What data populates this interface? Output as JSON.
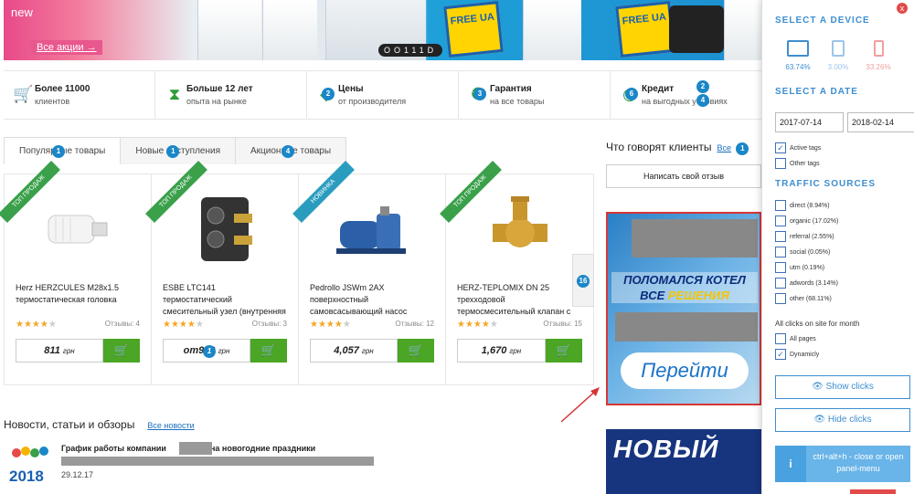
{
  "banner": {
    "new_label": "new",
    "all_promos_label": "Все акции →",
    "slider_dots": "OO111D",
    "free_badge_text": "FREE UA"
  },
  "features": [
    {
      "icon": "cart-icon",
      "title": "Более 11000",
      "sub": "клиентов",
      "badge": ""
    },
    {
      "icon": "hourglass-icon",
      "title": "Больше 12 лет",
      "sub": "опыта на рынке",
      "badge": ""
    },
    {
      "icon": "price-tag-icon",
      "title": "Цены",
      "sub": "от производителя",
      "badge": "2"
    },
    {
      "icon": "guarantee-icon",
      "title": "Гарантия",
      "sub": "на все товары",
      "badge": "3"
    },
    {
      "icon": "credit-icon",
      "title": "Кредит",
      "sub": "на выгодных условиях",
      "badge": "6"
    }
  ],
  "feature_extra_badges": {
    "credit_top": "2",
    "credit_bottom": "4"
  },
  "tabs": [
    {
      "label": "Популярные товары",
      "badge": "1"
    },
    {
      "label": "Новые поступления",
      "badge": "1"
    },
    {
      "label": "Акционные товары",
      "badge": "4"
    }
  ],
  "products": [
    {
      "ribbon": "ТОП ПРОДАЖ",
      "ribbon_type": "top",
      "name": "Herz HERZCULES M28x1.5 термостатическая головка",
      "stars": "★★★★",
      "star_off": "★",
      "reviews": "Отзывы: 4",
      "price": "811",
      "currency": "грн",
      "badge": ""
    },
    {
      "ribbon": "ТОП ПРОДАЖ",
      "ribbon_type": "top",
      "name": "ESBE LTC141 термостатический смесительный узел (внутренняя",
      "stars": "★★★★",
      "star_off": "★",
      "reviews": "Отзывы: 3",
      "price": "от9,  0",
      "currency": "грн",
      "badge": "1"
    },
    {
      "ribbon": "НОВИНКА",
      "ribbon_type": "new",
      "name": "Pedrollo JSWm 2AX поверхностный самовсасывающий насос",
      "stars": "★★★★",
      "star_off": "★",
      "reviews": "Отзывы: 12",
      "price": "4,057",
      "currency": "грн",
      "badge": ""
    },
    {
      "ribbon": "ТОП ПРОДАЖ",
      "ribbon_type": "top",
      "name": "HERZ-TEPLOMIX DN 25 трехходовой термосмесительный клапан с",
      "stars": "★★★★",
      "star_off": "★",
      "reviews": "Отзывы: 15",
      "price": "1,670",
      "currency": "грн",
      "badge": ""
    }
  ],
  "next_arrow_badge": "16",
  "reviews": {
    "title": "Что говорят клиенты",
    "all_link": "Все",
    "badge": "1",
    "write_button": "Написать свой отзыв"
  },
  "ad": {
    "line1": "ПОЛОМАЛСЯ КОТЕЛ",
    "line2_pre": "ВСЕ ",
    "line2_yellow": "РЕШЕНИЯ",
    "go_label": "Перейти",
    "ad2_text": "НОВЫЙ"
  },
  "news": {
    "title": "Новости, статьи и обзоры",
    "all_link": "Все новости",
    "headline_start": "График работы компании",
    "headline_end": "на новогодние праздники",
    "date": "29.12.17",
    "logo_year": "2018"
  },
  "panel": {
    "close_label": "x",
    "select_device": "SELECT A DEVICE",
    "devices": [
      {
        "name": "desktop",
        "pct": "63.74%",
        "color": "#3e8ed0"
      },
      {
        "name": "tablet",
        "pct": "3.00%",
        "color": "#9cc4ea"
      },
      {
        "name": "mobile",
        "pct": "33.26%",
        "color": "#f0a0a0"
      }
    ],
    "select_date": "SELECT A DATE",
    "date_from": "2017-07-14",
    "date_to": "2018-02-14",
    "tag_options": [
      {
        "label": "Active tags",
        "checked": true
      },
      {
        "label": "Other tags",
        "checked": false
      }
    ],
    "traffic_sources_title": "TRAFFIC SOURCES",
    "traffic_sources": [
      {
        "label": "direct (8.94%)",
        "checked": false
      },
      {
        "label": "organic (17.02%)",
        "checked": false
      },
      {
        "label": "referral (2.55%)",
        "checked": false
      },
      {
        "label": "social (0.05%)",
        "checked": false
      },
      {
        "label": "utm (0.19%)",
        "checked": false
      },
      {
        "label": "adwords (3.14%)",
        "checked": false
      },
      {
        "label": "other (68.11%)",
        "checked": false
      }
    ],
    "clicks_label": "All clicks on site for month",
    "click_options": [
      {
        "label": "All pages",
        "checked": false
      },
      {
        "label": "Dynamicly",
        "checked": true
      }
    ],
    "show_clicks": "Show clicks",
    "hide_clicks": "Hide clicks",
    "help_icon": "i",
    "help_text": "ctrl+alt+h - close or open panel-menu"
  }
}
